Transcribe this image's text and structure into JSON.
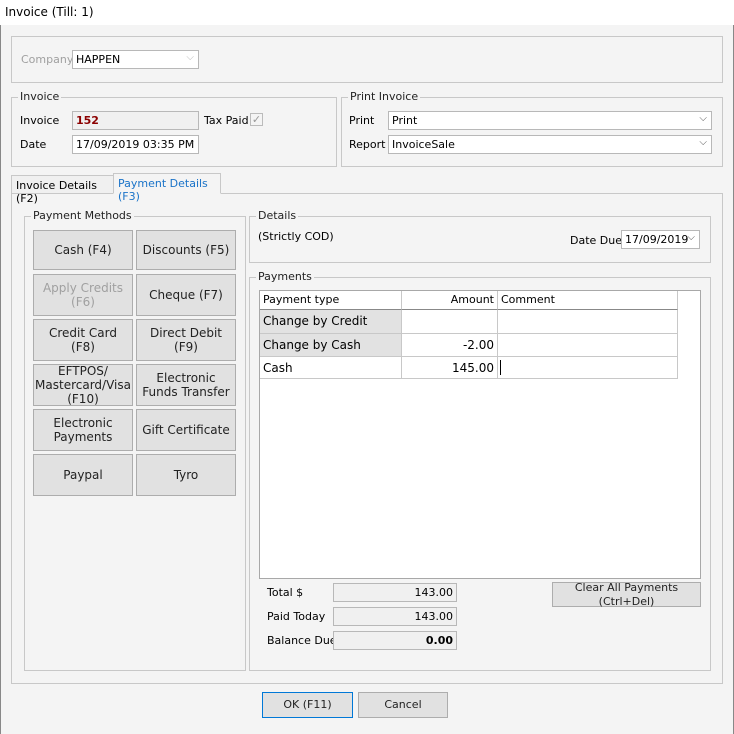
{
  "window": {
    "title": "Invoice (Till: 1)"
  },
  "company": {
    "label": "Company",
    "value": "HAPPEN"
  },
  "invoice": {
    "group_label": "Invoice",
    "invoice_label": "Invoice",
    "invoice_number": "152",
    "tax_paid_label": "Tax Paid",
    "tax_paid_checked": true,
    "date_label": "Date",
    "date_value": "17/09/2019 03:35 PM"
  },
  "print_invoice": {
    "group_label": "Print Invoice",
    "print_label": "Print",
    "print_value": "Print",
    "report_label": "Report",
    "report_value": "InvoiceSale"
  },
  "tabs": [
    {
      "label": "Invoice Details (F2)",
      "active": false
    },
    {
      "label": "Payment Details (F3)",
      "active": true
    }
  ],
  "payment_methods": {
    "group_label": "Payment Methods",
    "buttons": [
      {
        "label": "Cash (F4)",
        "enabled": true
      },
      {
        "label": "Discounts (F5)",
        "enabled": true
      },
      {
        "label": "Apply Credits (F6)",
        "enabled": false
      },
      {
        "label": "Cheque (F7)",
        "enabled": true
      },
      {
        "label": "Credit Card (F8)",
        "enabled": true
      },
      {
        "label": "Direct Debit (F9)",
        "enabled": true
      },
      {
        "label": "EFTPOS/ Mastercard/Visa (F10)",
        "enabled": true
      },
      {
        "label": "Electronic Funds Transfer",
        "enabled": true
      },
      {
        "label": "Electronic Payments",
        "enabled": true
      },
      {
        "label": "Gift Certificate",
        "enabled": true
      },
      {
        "label": "Paypal",
        "enabled": true
      },
      {
        "label": "Tyro",
        "enabled": true
      }
    ]
  },
  "details": {
    "group_label": "Details",
    "terms": "(Strictly COD)",
    "date_due_label": "Date Due",
    "date_due_value": "17/09/2019"
  },
  "payments": {
    "group_label": "Payments",
    "columns": [
      "Payment type",
      "Amount",
      "Comment"
    ],
    "rows": [
      {
        "type": "Change by Credit",
        "amount": "",
        "comment": ""
      },
      {
        "type": "Change by Cash",
        "amount": "-2.00",
        "comment": ""
      },
      {
        "type": "Cash",
        "amount": "145.00",
        "comment": ""
      }
    ]
  },
  "totals": {
    "total_label": "Total $",
    "total_value": "143.00",
    "paid_label": "Paid Today",
    "paid_value": "143.00",
    "balance_label": "Balance Due",
    "balance_value": "0.00"
  },
  "buttons": {
    "clear": "Clear All Payments (Ctrl+Del)",
    "ok": "OK (F11)",
    "cancel": "Cancel"
  },
  "colors": {
    "invoice_number": "#8b0000",
    "active_tab": "#1a73c8"
  }
}
